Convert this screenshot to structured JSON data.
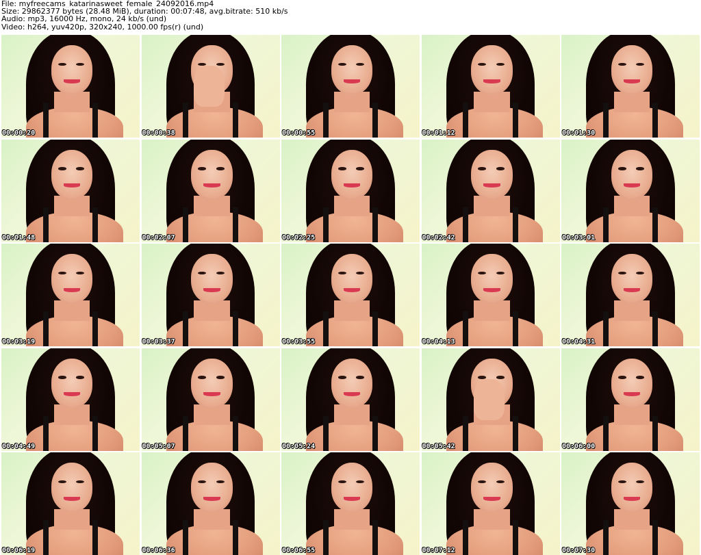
{
  "header": {
    "file": "File: myfreecams_katarinasweet_female_24092016.mp4",
    "size": "Size: 29862377 bytes (28.48 MiB), duration: 00:07:48, avg.bitrate: 510 kb/s",
    "audio": "Audio: mp3, 16000 Hz, mono, 24 kb/s (und)",
    "video": "Video: h264, yuv420p, 320x240, 1000.00 fps(r) (und)"
  },
  "thumbnails": [
    {
      "time": "00:00:20"
    },
    {
      "time": "00:00:38",
      "hand": true
    },
    {
      "time": "00:00:55"
    },
    {
      "time": "00:01:12"
    },
    {
      "time": "00:01:30"
    },
    {
      "time": "00:01:48"
    },
    {
      "time": "00:02:07"
    },
    {
      "time": "00:02:25"
    },
    {
      "time": "00:02:42"
    },
    {
      "time": "00:03:01"
    },
    {
      "time": "00:03:19"
    },
    {
      "time": "00:03:37"
    },
    {
      "time": "00:03:55"
    },
    {
      "time": "00:04:13"
    },
    {
      "time": "00:04:31"
    },
    {
      "time": "00:04:49"
    },
    {
      "time": "00:05:07"
    },
    {
      "time": "00:05:24"
    },
    {
      "time": "00:05:42",
      "hand": true
    },
    {
      "time": "00:06:00"
    },
    {
      "time": "00:06:19"
    },
    {
      "time": "00:06:36"
    },
    {
      "time": "00:06:55"
    },
    {
      "time": "00:07:12"
    },
    {
      "time": "00:07:30"
    }
  ]
}
